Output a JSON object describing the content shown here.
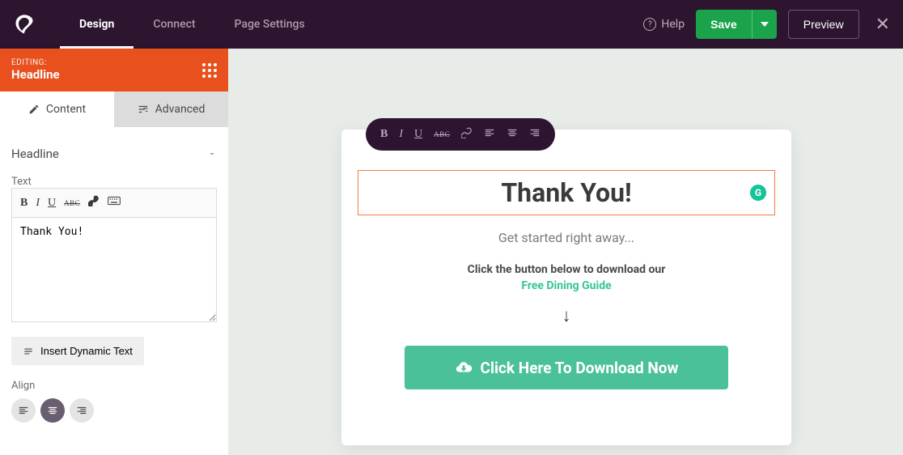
{
  "topbar": {
    "tabs": [
      "Design",
      "Connect",
      "Page Settings"
    ],
    "active_tab": 0,
    "help_label": "Help",
    "save_label": "Save",
    "preview_label": "Preview"
  },
  "sidebar": {
    "editing_label": "EDITING:",
    "editing_title": "Headline",
    "panel_tabs": {
      "content": "Content",
      "advanced": "Advanced"
    },
    "active_panel": "content",
    "accordion_title": "Headline",
    "text_field_label": "Text",
    "text_value": "Thank You!",
    "dynamic_text_btn": "Insert Dynamic Text",
    "align_label": "Align",
    "align_active": "center"
  },
  "canvas": {
    "headline": "Thank You!",
    "subheadline": "Get started right away...",
    "instruction": "Click the button below to download our",
    "guide_link": "Free Dining Guide",
    "arrow_glyph": "↓",
    "cta_label": "Click Here To Download Now"
  },
  "colors": {
    "accent_orange": "#e8501e",
    "brand_dark": "#2d1530",
    "save_green": "#1aa34a",
    "cta_green": "#4bc19a",
    "link_teal": "#37c398"
  }
}
